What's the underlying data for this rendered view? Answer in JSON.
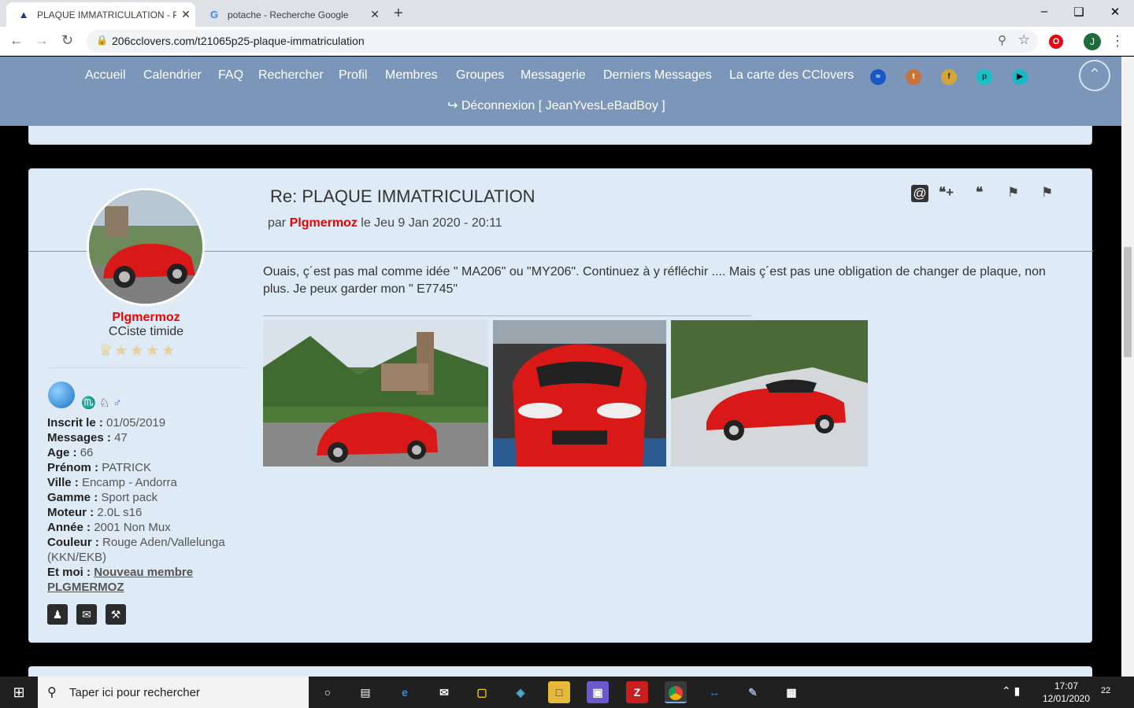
{
  "browser": {
    "tabs": [
      {
        "title": "PLAQUE IMMATRICULATION - Pa",
        "active": true
      },
      {
        "title": "potache - Recherche Google",
        "active": false
      }
    ],
    "url": "206cclovers.com/t21065p25-plaque-immatriculation",
    "profile_initial": "J"
  },
  "site_nav": {
    "items": [
      "Accueil",
      "Calendrier",
      "FAQ",
      "Rechercher",
      "Profil",
      "Membres",
      "Groupes",
      "Messagerie",
      "Derniers Messages",
      "La carte des CClovers"
    ],
    "logout": "Déconnexion [ JeanYvesLeBadBoy ]"
  },
  "post": {
    "title": "Re: PLAQUE IMMATRICULATION",
    "meta_prefix": "par",
    "author": "Plgmermoz",
    "date": "le Jeu 9 Jan 2020 - 20:11",
    "body": "Ouais, ç´est pas mal comme idée \" MA206\" ou \"MY206\". Continuez à y réfléchir .... Mais ç´est pas une obligation de changer de plaque, non plus. Je peux garder mon \" E7745\""
  },
  "user": {
    "name": "Plgmermoz",
    "rank": "CCiste timide",
    "rating_stars": 4,
    "fields": [
      {
        "label": "Inscrit le",
        "value": "01/05/2019"
      },
      {
        "label": "Messages",
        "value": "47"
      },
      {
        "label": "Age",
        "value": "66"
      },
      {
        "label": "Prénom",
        "value": "PATRICK"
      },
      {
        "label": "Ville",
        "value": "Encamp - Andorra"
      },
      {
        "label": "Gamme",
        "value": "Sport pack"
      },
      {
        "label": "Moteur",
        "value": "2.0L s16"
      },
      {
        "label": "Année",
        "value": "2001 Non Mux"
      },
      {
        "label": "Couleur",
        "value": "Rouge Aden/Vallelunga (KKN/EKB)"
      }
    ],
    "et_moi_label": "Et moi",
    "et_moi_link": "Nouveau membre PLGMERMOZ"
  },
  "taskbar": {
    "search_placeholder": "Taper ici pour rechercher",
    "time": "17:07",
    "date": "12/01/2020",
    "notifications": "22"
  },
  "colors": {
    "accent": "#7b96b8",
    "post_bg": "#deeaf6",
    "author": "#ee0000"
  }
}
